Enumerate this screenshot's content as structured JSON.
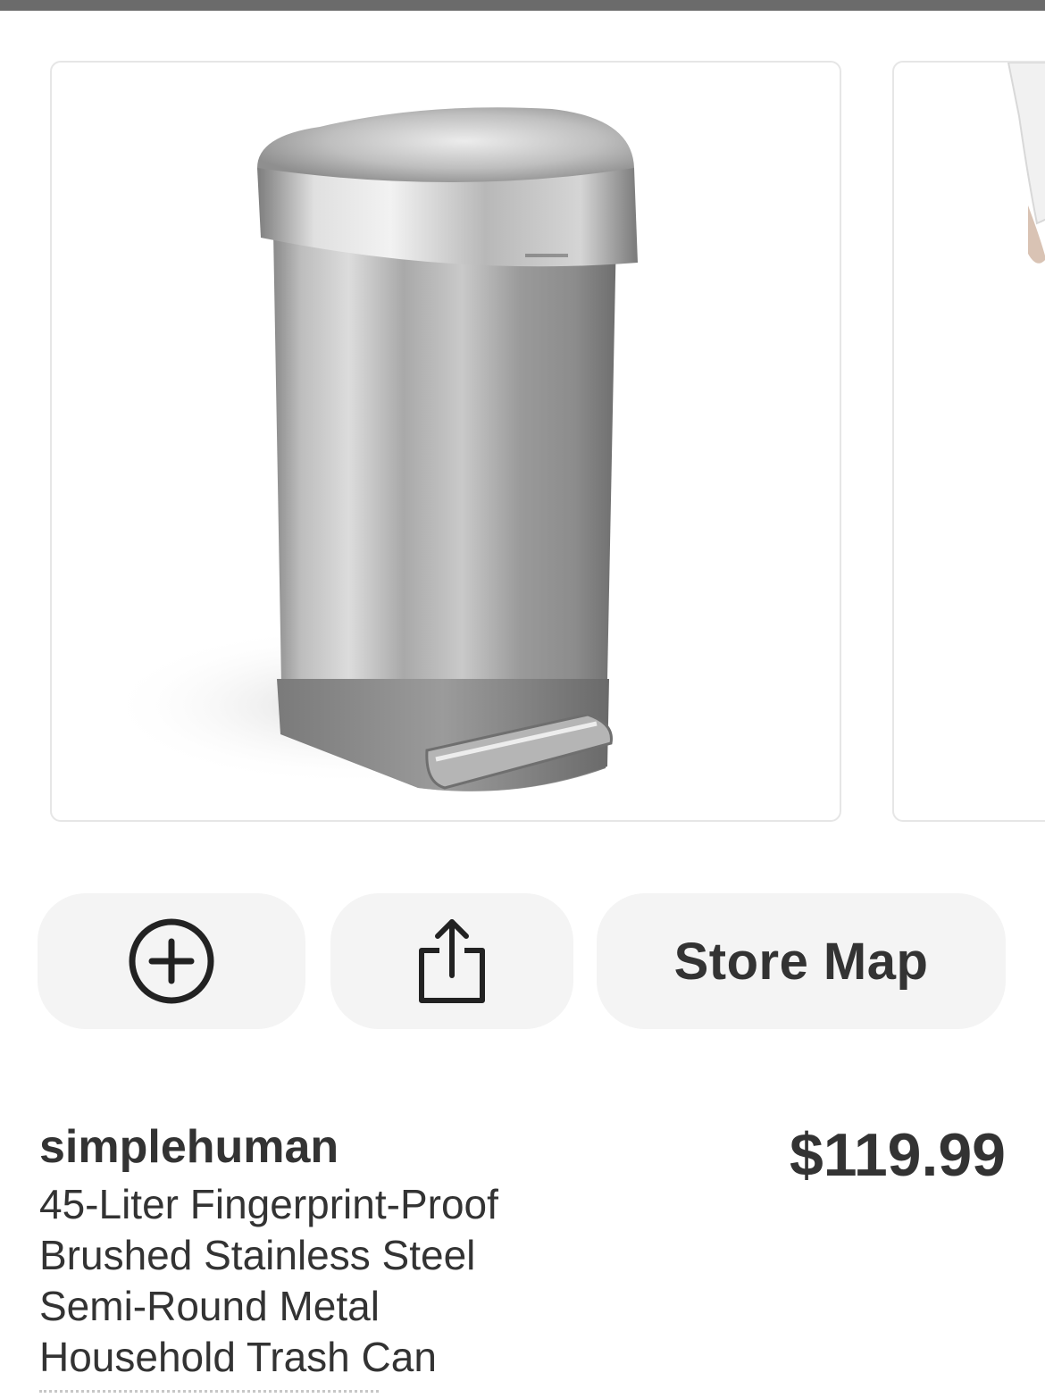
{
  "product": {
    "brand": "simplehuman",
    "title_lines": [
      "45-Liter Fingerprint-Proof",
      "Brushed Stainless Steel",
      "Semi-Round Metal",
      "Household Trash Can"
    ],
    "price": "$119.99",
    "image_icon": "stainless-steel-trash-can"
  },
  "actions": {
    "add_icon": "plus-circle-icon",
    "share_icon": "share-icon",
    "store_map_label": "Store Map"
  },
  "colors": {
    "text": "#333333",
    "pill_background": "#f4f4f4",
    "top_bar": "#6b6b6b"
  }
}
